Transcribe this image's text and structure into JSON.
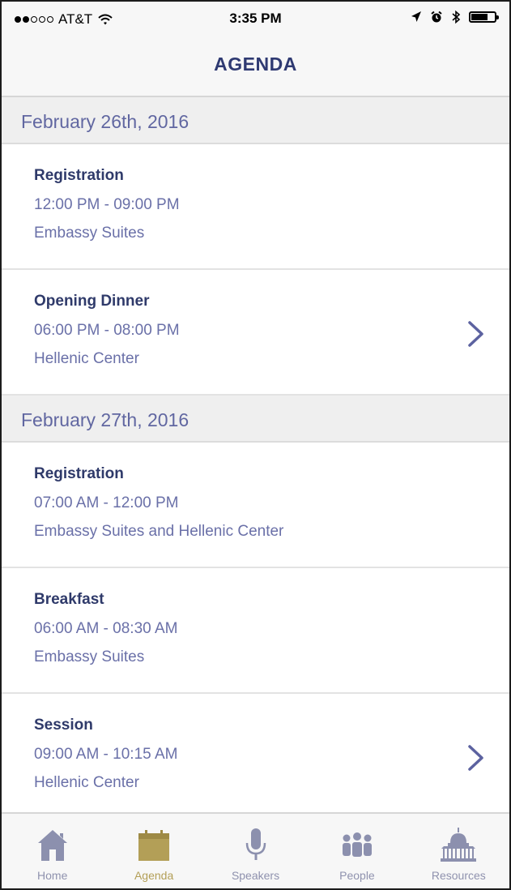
{
  "status_bar": {
    "carrier": "AT&T",
    "time": "3:35 PM"
  },
  "nav": {
    "title": "AGENDA"
  },
  "days": [
    {
      "date": "February 26th, 2016",
      "events": [
        {
          "title": "Registration",
          "time": "12:00 PM - 09:00 PM",
          "place": "Embassy Suites",
          "has_detail": false
        },
        {
          "title": "Opening Dinner",
          "time": "06:00 PM - 08:00 PM",
          "place": "Hellenic Center",
          "has_detail": true
        }
      ]
    },
    {
      "date": "February 27th, 2016",
      "events": [
        {
          "title": "Registration",
          "time": "07:00 AM - 12:00 PM",
          "place": "Embassy Suites and Hellenic Center",
          "has_detail": false
        },
        {
          "title": "Breakfast",
          "time": "06:00 AM - 08:30 AM",
          "place": "Embassy Suites",
          "has_detail": false
        },
        {
          "title": "Session",
          "time": "09:00 AM - 10:15 AM",
          "place": "Hellenic Center",
          "has_detail": true
        }
      ]
    }
  ],
  "tabs": [
    {
      "label": "Home",
      "icon": "home-icon",
      "active": false
    },
    {
      "label": "Agenda",
      "icon": "calendar-icon",
      "active": true
    },
    {
      "label": "Speakers",
      "icon": "microphone-icon",
      "active": false
    },
    {
      "label": "People",
      "icon": "people-icon",
      "active": false
    },
    {
      "label": "Resources",
      "icon": "capitol-building-icon",
      "active": false
    }
  ],
  "colors": {
    "title": "#2f3a72",
    "accent": "#6a70a8",
    "active_tab": "#b39f57",
    "inactive_tab": "#8f92ae"
  }
}
